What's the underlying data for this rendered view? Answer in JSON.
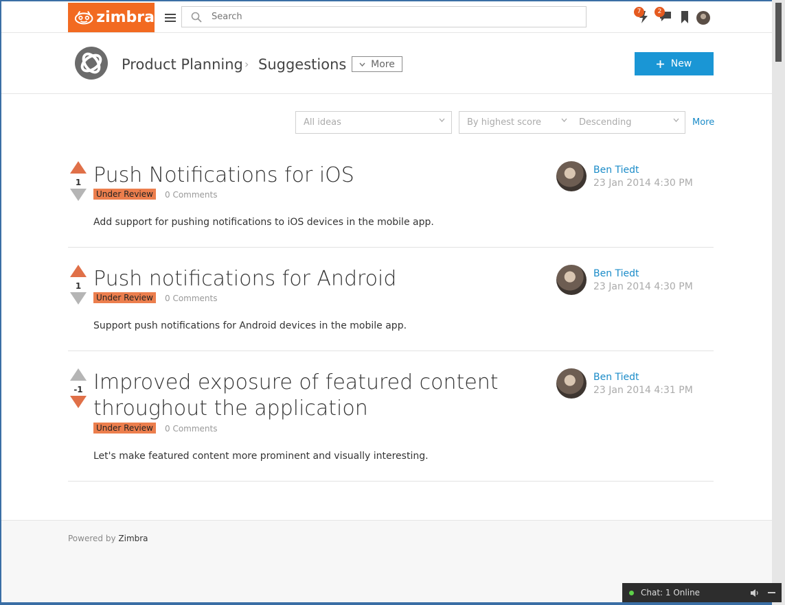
{
  "header": {
    "logo_text": "zimbra",
    "search_placeholder": "Search",
    "notifications_count": "7",
    "messages_count": "2"
  },
  "place": {
    "breadcrumb_parent": "Product Planning",
    "breadcrumb_current": "Suggestions",
    "more_label": "More",
    "new_label": "New"
  },
  "filters": {
    "ideas_filter": "All ideas",
    "sort_by": "By highest score",
    "sort_order": "Descending",
    "more_label": "More"
  },
  "ideas": [
    {
      "score": "1",
      "title": "Push Notifications for iOS",
      "status": "Under Review",
      "comments": "0 Comments",
      "description": "Add support for pushing notifications to iOS devices in the mobile app.",
      "author": "Ben Tiedt",
      "date": "23 Jan 2014 4:30 PM"
    },
    {
      "score": "1",
      "title": "Push notifications for Android",
      "status": "Under Review",
      "comments": "0 Comments",
      "description": "Support push notifications for Android devices in the mobile app.",
      "author": "Ben Tiedt",
      "date": "23 Jan 2014 4:30 PM"
    },
    {
      "score": "-1",
      "title": "Improved exposure of featured content throughout the application",
      "status": "Under Review",
      "comments": "0 Comments",
      "description": "Let's make featured content more prominent and visually interesting.",
      "author": "Ben Tiedt",
      "date": "23 Jan 2014 4:31 PM"
    }
  ],
  "footer": {
    "powered_prefix": "Powered by",
    "powered_brand": "Zimbra"
  },
  "chat": {
    "label": "Chat: 1 Online"
  },
  "colors": {
    "brand": "#f26a21",
    "accent": "#1a96d5",
    "status": "#ec7e4d"
  }
}
